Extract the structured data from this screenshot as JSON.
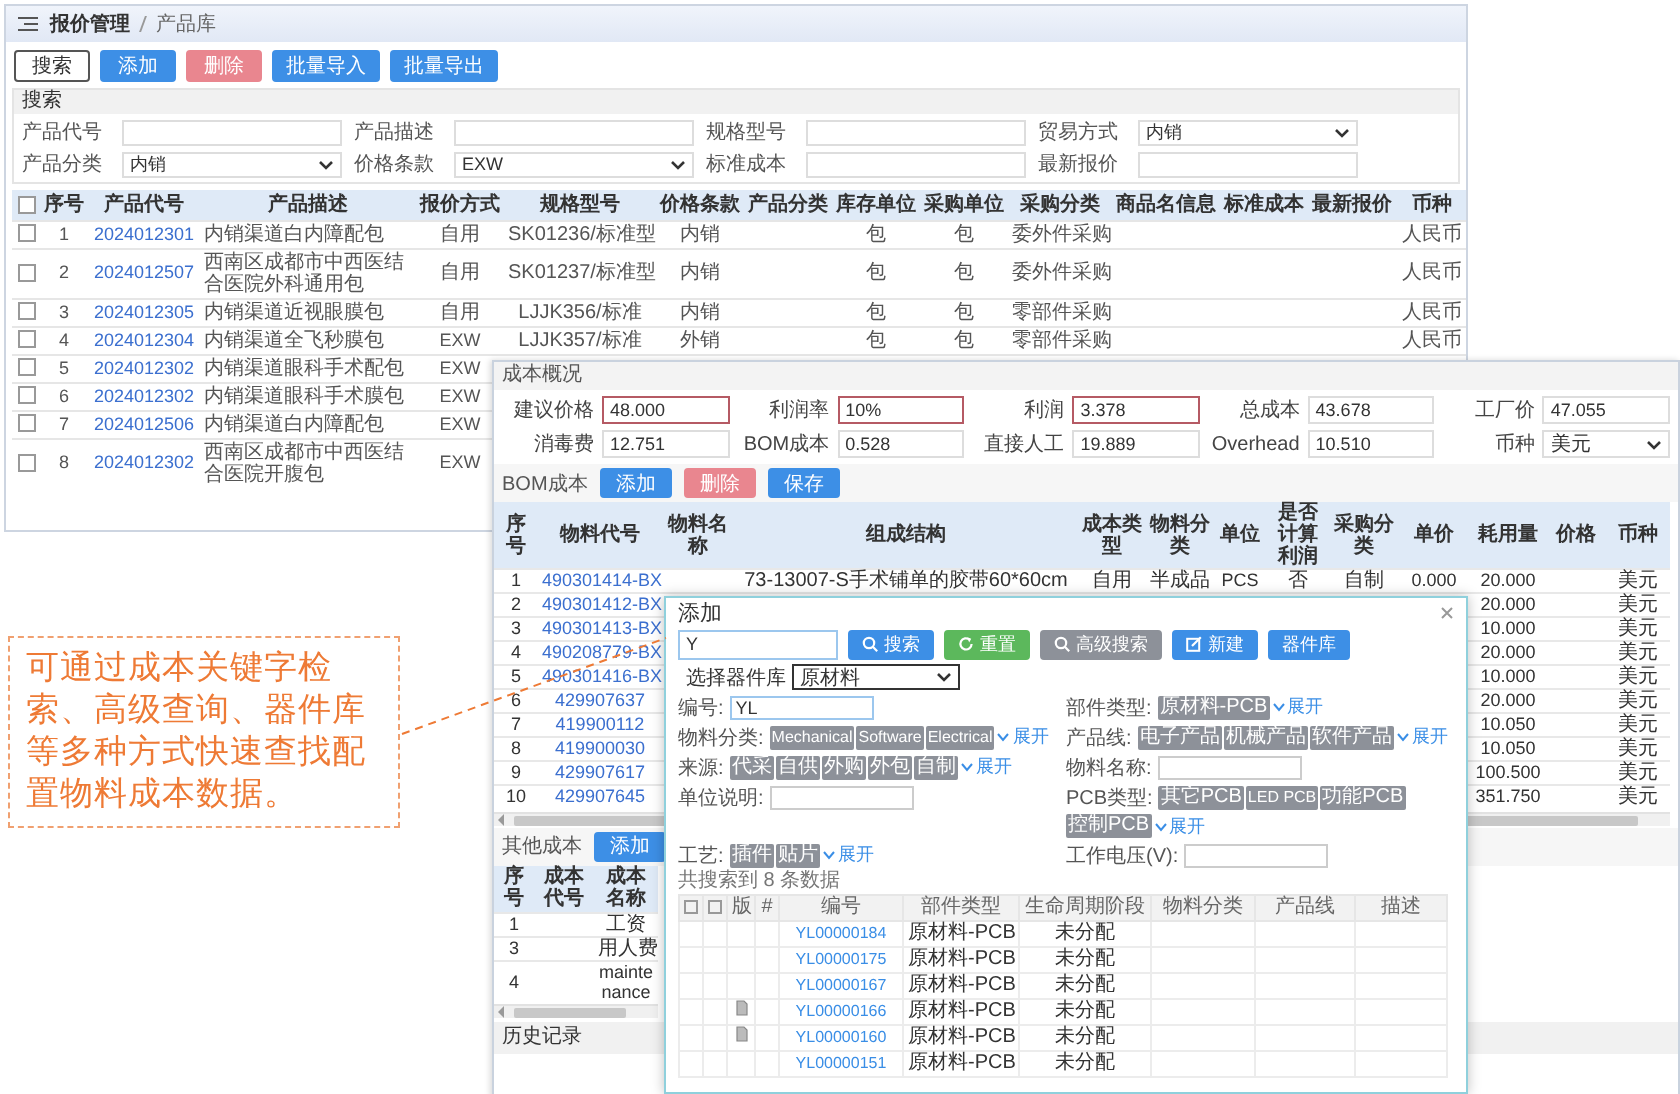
{
  "breadcrumb": {
    "section": "报价管理",
    "page": "产品库"
  },
  "toolbar": [
    {
      "label": "搜索",
      "kind": "outline"
    },
    {
      "label": "添加",
      "kind": "primary"
    },
    {
      "label": "删除",
      "kind": "danger"
    },
    {
      "label": "批量导入",
      "kind": "primary"
    },
    {
      "label": "批量导出",
      "kind": "primary"
    }
  ],
  "search_panel": {
    "title": "搜索",
    "fields": [
      {
        "label": "产品代号",
        "kind": "input"
      },
      {
        "label": "产品描述",
        "kind": "input"
      },
      {
        "label": "规格型号",
        "kind": "input"
      },
      {
        "label": "贸易方式",
        "kind": "select",
        "value": "内销"
      },
      {
        "label": "产品分类",
        "kind": "select",
        "value": "内销"
      },
      {
        "label": "价格条款",
        "kind": "select",
        "value": "EXW"
      },
      {
        "label": "标准成本",
        "kind": "input"
      },
      {
        "label": "最新报价",
        "kind": "input"
      }
    ]
  },
  "product_table": {
    "header_checked": false,
    "columns": [
      "序号",
      "产品代号",
      "产品描述",
      "报价方式",
      "规格型号",
      "价格条款",
      "产品分类",
      "库存单位",
      "采购单位",
      "采购分类",
      "商品名信息",
      "标准成本",
      "最新报价",
      "币种"
    ],
    "rows": [
      {
        "checked": false,
        "cells": [
          "1",
          "2024012301",
          "内销渠道白内障配包",
          "自用",
          "SK01236/标准型",
          "内销",
          null,
          "包",
          "包",
          "委外件采购",
          null,
          null,
          null,
          "人民币"
        ]
      },
      {
        "checked": false,
        "cells": [
          "2",
          "2024012507",
          "西南区成都市中西医结合医院外科通用包",
          "自用",
          "SK01237/标准型",
          "内销",
          null,
          "包",
          "包",
          "委外件采购",
          null,
          null,
          null,
          "人民币"
        ]
      },
      {
        "checked": false,
        "cells": [
          "3",
          "2024012305",
          "内销渠道近视眼膜包",
          "自用",
          "LJJK356/标准",
          "内销",
          null,
          "包",
          "包",
          "零部件采购",
          null,
          null,
          null,
          "人民币"
        ]
      },
      {
        "checked": false,
        "cells": [
          "4",
          "2024012304",
          "内销渠道全飞秒膜包",
          "EXW",
          "LJJK357/标准",
          "外销",
          null,
          "包",
          "包",
          "零部件采购",
          null,
          null,
          null,
          "人民币"
        ]
      },
      {
        "checked": false,
        "cells": [
          "5",
          "2024012302",
          "内销渠道眼科手术配包",
          "EXW"
        ]
      },
      {
        "checked": false,
        "cells": [
          "6",
          "2024012302",
          "内销渠道眼科手术膜包",
          "EXW"
        ]
      },
      {
        "checked": false,
        "cells": [
          "7",
          "2024012506",
          "内销渠道白内障配包",
          "EXW"
        ]
      },
      {
        "checked": false,
        "cells": [
          "8",
          "2024012302",
          "西南区成都市中西医结合医院开腹包",
          "EXW"
        ]
      }
    ]
  },
  "cost_panel": {
    "title": "成本概况",
    "fields": [
      {
        "label": "建议价格",
        "value": "48.000",
        "kind": "input",
        "highlighted": true
      },
      {
        "label": "利润率",
        "value": "10%",
        "kind": "input",
        "highlighted": true
      },
      {
        "label": "利润",
        "value": "3.378",
        "kind": "input",
        "highlighted": true
      },
      {
        "label": "总成本",
        "value": "43.678",
        "kind": "input",
        "highlighted": false
      },
      {
        "label": "工厂价",
        "value": "47.055",
        "kind": "input",
        "highlighted": false
      },
      {
        "label": "消毒费",
        "value": "12.751",
        "kind": "input",
        "highlighted": false
      },
      {
        "label": "BOM成本",
        "value": "0.528",
        "kind": "input",
        "highlighted": false
      },
      {
        "label": "直接人工",
        "value": "19.889",
        "kind": "input",
        "highlighted": false
      },
      {
        "label": "Overhead",
        "value": "10.510",
        "kind": "input",
        "highlighted": false
      },
      {
        "label": "币种",
        "value": "美元",
        "kind": "select",
        "highlighted": false
      }
    ],
    "bom": {
      "title": "BOM成本",
      "buttons": [
        {
          "label": "添加",
          "kind": "primary"
        },
        {
          "label": "删除",
          "kind": "danger"
        },
        {
          "label": "保存",
          "kind": "primary"
        }
      ],
      "columns": [
        "序号",
        "物料代号",
        "物料名称",
        "组成结构",
        "成本类型",
        "物料分类",
        "单位",
        "是否计算利润",
        "采购分类",
        "单价",
        "耗用量",
        "价格",
        "币种"
      ],
      "rows": [
        {
          "cells": [
            "1",
            "490301414-BX",
            null,
            "73-13007-S手术铺单的胶带60*60cm",
            "自用",
            "半成品",
            "PCS",
            "否",
            "自制",
            "0.000",
            "20.000",
            null,
            "美元"
          ]
        },
        {
          "cells": [
            "2",
            "490301412-BX",
            null,
            null,
            null,
            null,
            null,
            null,
            null,
            null,
            "20.000",
            null,
            "美元"
          ]
        },
        {
          "cells": [
            "3",
            "490301413-BX",
            null,
            null,
            null,
            null,
            null,
            null,
            null,
            null,
            "10.000",
            null,
            "美元"
          ]
        },
        {
          "cells": [
            "4",
            "490208779-BX",
            null,
            null,
            null,
            null,
            null,
            null,
            null,
            null,
            "20.000",
            null,
            "美元"
          ]
        },
        {
          "cells": [
            "5",
            "490301416-BX",
            null,
            null,
            null,
            null,
            null,
            null,
            null,
            null,
            "10.000",
            null,
            "美元"
          ]
        },
        {
          "cells": [
            "6",
            "429907637",
            null,
            null,
            null,
            null,
            null,
            null,
            null,
            null,
            "20.000",
            null,
            "美元"
          ]
        },
        {
          "cells": [
            "7",
            "419900112",
            null,
            null,
            null,
            null,
            null,
            null,
            null,
            null,
            "10.050",
            null,
            "美元"
          ]
        },
        {
          "cells": [
            "8",
            "419900030",
            null,
            null,
            null,
            null,
            null,
            null,
            null,
            null,
            "10.050",
            null,
            "美元"
          ]
        },
        {
          "cells": [
            "9",
            "429907617",
            null,
            null,
            null,
            null,
            null,
            null,
            null,
            null,
            "100.500",
            null,
            "美元"
          ]
        },
        {
          "cells": [
            "10",
            "429907645",
            null,
            null,
            null,
            null,
            null,
            null,
            null,
            null,
            "351.750",
            null,
            "美元"
          ]
        }
      ]
    },
    "other_costs": {
      "title": "其他成本",
      "buttons": [
        {
          "label": "添加",
          "kind": "primary"
        }
      ],
      "columns": [
        "序号",
        "成本代号",
        "成本名称"
      ],
      "rows": [
        {
          "cells": [
            "1",
            null,
            "工资"
          ]
        },
        {
          "cells": [
            "3",
            null,
            "用人费"
          ]
        },
        {
          "cells": [
            "4",
            null,
            "maintenance"
          ]
        }
      ]
    },
    "history": {
      "title": "历史记录"
    }
  },
  "dialog": {
    "title": "添加",
    "search_value": "Y",
    "buttons": [
      {
        "label": "搜索",
        "kind": "primary"
      },
      {
        "label": "重置",
        "kind": "success"
      },
      {
        "label": "高级搜索",
        "kind": "default"
      },
      {
        "label": "新建",
        "kind": "primary"
      },
      {
        "label": "器件库",
        "kind": "primary"
      }
    ],
    "library": {
      "label": "选择器件库",
      "value": "原材料"
    },
    "filters": [
      {
        "label": "编号:",
        "kind": "input",
        "value": "YL"
      },
      {
        "label": "部件类型:",
        "kind": "tags",
        "tags": [
          "原材料-PCB"
        ],
        "expand": "展开"
      },
      {
        "label": "物料分类:",
        "kind": "tags",
        "tags": [
          "Mechanical",
          "Software",
          "Electrical"
        ],
        "expand": "展开"
      },
      {
        "label": "产品线:",
        "kind": "tags",
        "tags": [
          "电子产品",
          "机械产品",
          "软件产品"
        ],
        "expand": "展开"
      },
      {
        "label": "来源:",
        "kind": "tags",
        "tags": [
          "代采",
          "自供",
          "外购",
          "外包",
          "自制"
        ],
        "expand": "展开"
      },
      {
        "label": "物料名称:",
        "kind": "input"
      },
      {
        "label": "单位说明:",
        "kind": "input"
      },
      {
        "label": "PCB类型:",
        "kind": "tags",
        "tags": [
          "其它PCB",
          "LED PCB",
          "功能PCB",
          "控制PCB"
        ],
        "expand": "展开"
      },
      {
        "label": "工艺:",
        "kind": "tags",
        "tags": [
          "插件",
          "贴片"
        ],
        "expand": "展开"
      },
      {
        "label": "工作电压(V):",
        "kind": "input"
      }
    ],
    "result_count": "共搜索到 8 条数据",
    "table": {
      "header_checks": [
        {
          "checked": false
        },
        {
          "checked": false
        }
      ],
      "columns": [
        "版",
        "#",
        "编号",
        "部件类型",
        "生命周期阶段",
        "物料分类",
        "产品线",
        "描述"
      ],
      "rows": [
        {
          "version_icon": false,
          "code": "YL00000184",
          "type": "原材料-PCB",
          "stage": "未分配"
        },
        {
          "version_icon": false,
          "code": "YL00000175",
          "type": "原材料-PCB",
          "stage": "未分配"
        },
        {
          "version_icon": false,
          "code": "YL00000167",
          "type": "原材料-PCB",
          "stage": "未分配"
        },
        {
          "version_icon": true,
          "code": "YL00000166",
          "type": "原材料-PCB",
          "stage": "未分配"
        },
        {
          "version_icon": true,
          "code": "YL00000160",
          "type": "原材料-PCB",
          "stage": "未分配"
        },
        {
          "version_icon": false,
          "code": "YL00000151",
          "type": "原材料-PCB",
          "stage": "未分配"
        }
      ]
    }
  },
  "callout": {
    "text": "可通过成本关键字检索、高级查询、器件库等多种方式快速查找配置物料成本数据。"
  }
}
